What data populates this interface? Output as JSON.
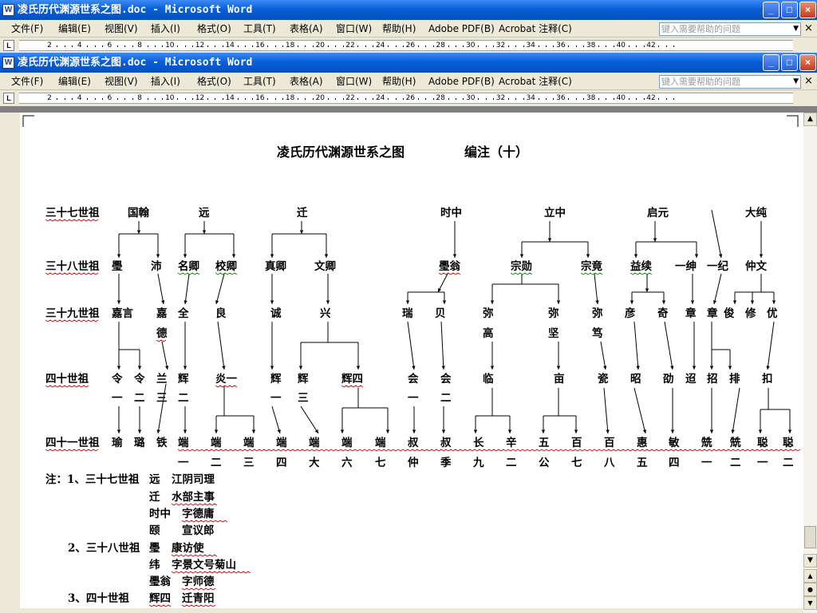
{
  "window": {
    "title": "凌氏历代渊源世系之图.doc - Microsoft Word",
    "buttons": [
      "_",
      "□",
      "×"
    ]
  },
  "menu": {
    "items": [
      "文件(F)",
      "编辑(E)",
      "视图(V)",
      "插入(I)",
      "格式(O)",
      "工具(T)",
      "表格(A)",
      "窗口(W)",
      "帮助(H)",
      "Adobe PDF(B)",
      "Acrobat 注释(C)"
    ],
    "help_placeholder": "键入需要帮助的问题",
    "close_doc": "×"
  },
  "ruler": {
    "ticks": [
      "2",
      "4",
      "6",
      "8",
      "10",
      "12",
      "14",
      "16",
      "18",
      "20",
      "22",
      "24",
      "26",
      "28",
      "30",
      "32",
      "34",
      "36",
      "38",
      "40",
      "42"
    ]
  },
  "document": {
    "title": "凌氏历代渊源世系之图",
    "subtitle": "编注（十）",
    "rows": [
      {
        "label": "三十七世祖",
        "names": [
          "国翰",
          "远",
          "迁",
          "时中",
          "立中",
          "启元",
          "大纯"
        ]
      },
      {
        "label": "三十八世祖",
        "names": [
          "璺",
          "沛",
          "名卿",
          "校卿",
          "真卿",
          "文卿",
          "璺翁",
          "宗勋",
          "宗竟",
          "益续",
          "一绅",
          "一纪",
          "仲文"
        ]
      },
      {
        "label": "三十九世祖",
        "names": [
          "嘉言",
          "嘉",
          "德",
          "全",
          "良",
          "诚",
          "兴",
          "瑞",
          "贝",
          "弥",
          "高",
          "弥",
          "坚",
          "弥",
          "笃",
          "彦",
          "奇",
          "章",
          "章",
          "俊",
          "修",
          "优"
        ]
      },
      {
        "label": "四十世祖",
        "names": [
          "令",
          "一",
          "令",
          "二",
          "兰",
          "三",
          "辉",
          "二",
          "炎一",
          "辉",
          "一",
          "辉",
          "三",
          "辉四",
          "会",
          "一",
          "会",
          "二",
          "临",
          "亩",
          "瓷",
          "昭",
          "劭",
          "迢",
          "招",
          "排",
          "扣"
        ]
      },
      {
        "label": "四十一世祖",
        "names": [
          "瑜",
          "璐",
          "铁",
          "端",
          "一",
          "端",
          "二",
          "端",
          "三",
          "端",
          "四",
          "端",
          "大",
          "端",
          "六",
          "端",
          "七",
          "叔",
          "仲",
          "叔",
          "季",
          "长",
          "九",
          "辛",
          "二",
          "五",
          "公",
          "百",
          "七",
          "百",
          "八",
          "惠",
          "五",
          "敏",
          "四",
          "兟",
          "一",
          "兟",
          "二",
          "聪",
          "一",
          "聪",
          "二"
        ]
      }
    ],
    "notes": [
      {
        "prefix": "注：1、三十七世祖",
        "name": "远",
        "desc": "江阴司理"
      },
      {
        "prefix": "",
        "name": "迁",
        "desc": "水部主事"
      },
      {
        "prefix": "",
        "name": "时中",
        "desc": "字德庸"
      },
      {
        "prefix": "",
        "name": "颐",
        "desc": "宣议郎"
      },
      {
        "prefix": "2、三十八世祖",
        "name": "璺",
        "desc": "康访使"
      },
      {
        "prefix": "",
        "name": "纬",
        "desc": "字景文号菊山"
      },
      {
        "prefix": "",
        "name": "璺翁",
        "desc": "字师德"
      },
      {
        "prefix": "3、四十世祖",
        "name": "辉四",
        "desc": "迁青阳"
      }
    ]
  },
  "colors": {
    "titlebar": "#0a5fd8",
    "chrome": "#ece9d8",
    "workspace": "#808080",
    "spell_underline": "#cc0000",
    "grammar_underline": "#008800"
  }
}
